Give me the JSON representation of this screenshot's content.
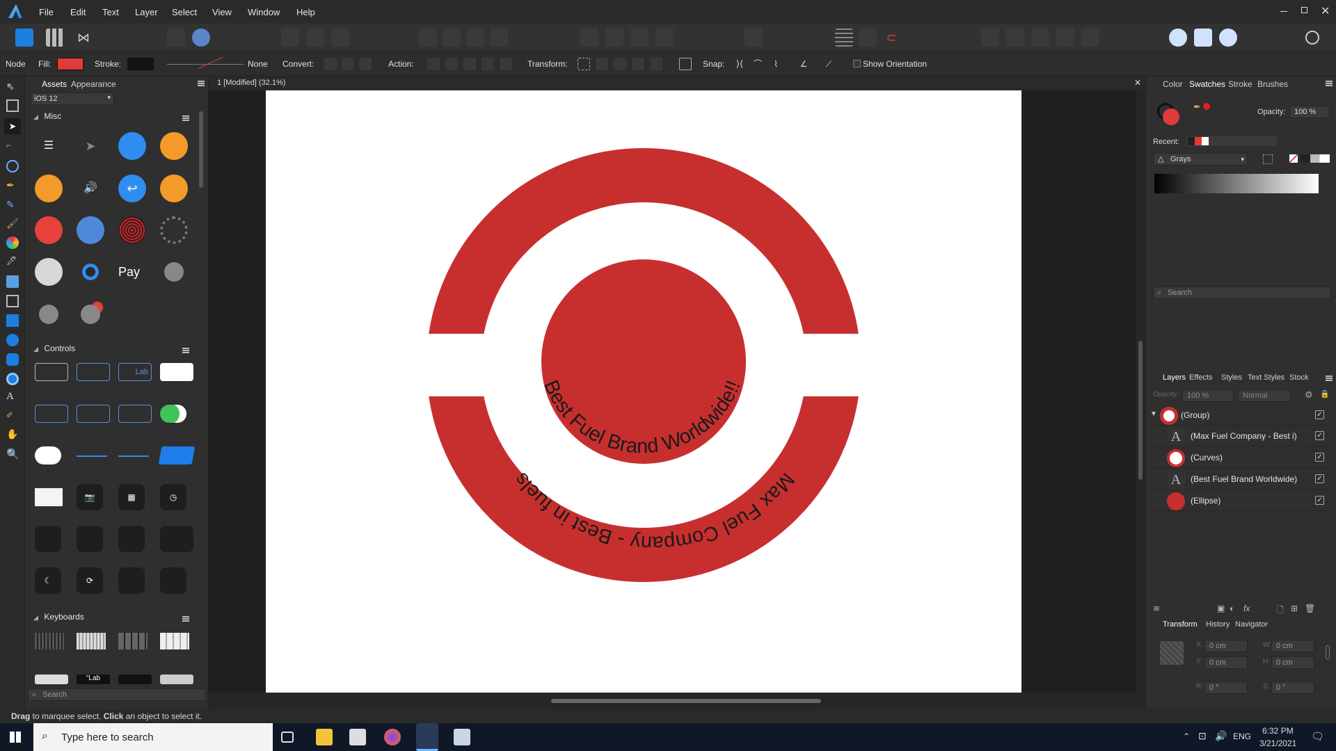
{
  "menu": [
    "File",
    "Edit",
    "Text",
    "Layer",
    "Select",
    "View",
    "Window",
    "Help"
  ],
  "context_bar": {
    "mode": "Node",
    "fill_label": "Fill:",
    "stroke_label": "Stroke:",
    "stroke_value": "None",
    "convert_label": "Convert:",
    "action_label": "Action:",
    "transform_label": "Transform:",
    "snap_label": "Snap:",
    "show_orientation": "Show Orientation",
    "fill_color": "#e03a3a",
    "stroke_color": "#141414"
  },
  "assets_panel": {
    "tabs": [
      "Assets",
      "Appearance"
    ],
    "category": "iOS 12",
    "sections": [
      "Misc",
      "Controls",
      "Keyboards"
    ],
    "keyboard_key_label": "\"Lab",
    "search_placeholder": "Search"
  },
  "document": {
    "tab_title": "1 [Modified] (32.1%)",
    "inner_text": "Best Fuel Brand Worldwide!!",
    "outer_text": "Max Fuel Company - Best in fuels",
    "brand_color": "#c72f2f"
  },
  "color_panel": {
    "tabs": [
      "Color",
      "Swatches",
      "Stroke",
      "Brushes"
    ],
    "opacity_label": "Opacity:",
    "opacity_value": "100 %",
    "recent_label": "Recent:",
    "palette": "Grays",
    "search_placeholder": "Search"
  },
  "layers_panel": {
    "tabs": [
      "Layers",
      "Effects",
      "Styles",
      "Text Styles",
      "Stock"
    ],
    "opacity_label": "Opacity:",
    "opacity_value": "100 %",
    "blend_mode": "Normal",
    "layers": [
      {
        "name": "(Group)",
        "icon": "group-thumb"
      },
      {
        "name": "(Max Fuel Company - Best i)",
        "icon": "text-thumb"
      },
      {
        "name": "(Curves)",
        "icon": "curves-thumb"
      },
      {
        "name": "(Best Fuel Brand Worldwide)",
        "icon": "text-thumb"
      },
      {
        "name": "(Ellipse)",
        "icon": "ellipse-thumb"
      }
    ]
  },
  "transform_panel": {
    "tabs": [
      "Transform",
      "History",
      "Navigator"
    ],
    "x_label": "X:",
    "x_value": "0 cm",
    "y_label": "Y:",
    "y_value": "0 cm",
    "w_label": "W:",
    "w_value": "0 cm",
    "h_label": "H:",
    "h_value": "0 cm",
    "r_label": "R:",
    "r_value": "0 °",
    "s_label": "S:",
    "s_value": "0 °"
  },
  "status": {
    "drag": "Drag",
    "drag_desc": " to marquee select. ",
    "click": "Click",
    "click_desc": " an object to select it."
  },
  "taskbar": {
    "search_placeholder": "Type here to search",
    "lang": "ENG",
    "time": "6:32 PM",
    "date": "3/21/2021"
  }
}
